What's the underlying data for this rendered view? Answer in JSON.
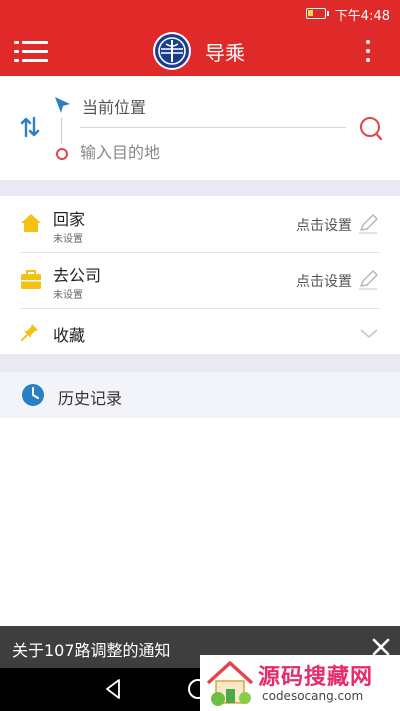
{
  "status_bar": {
    "time": "下午4:48",
    "battery_level": 0.35,
    "battery_color": "#ffd24a"
  },
  "app_bar": {
    "title": "导乘",
    "background_color": "#e02a2a",
    "menu_icon": "menu-icon",
    "logo_icon": "transit-logo-icon",
    "more_icon": "more-vertical-icon"
  },
  "route": {
    "start_text": "当前位置",
    "destination_placeholder": "输入目的地",
    "destination_value": "",
    "swap_icon": "swap-vertical-icon",
    "start_icon": "navigation-arrow-icon",
    "search_icon": "search-icon"
  },
  "places": {
    "home": {
      "label": "回家",
      "sub": "未设置",
      "action": "点击设置",
      "icon": "home-icon"
    },
    "company": {
      "label": "去公司",
      "sub": "未设置",
      "action": "点击设置",
      "icon": "briefcase-icon"
    },
    "favorites": {
      "label": "收藏",
      "icon": "pin-icon"
    }
  },
  "history": {
    "label": "历史记录",
    "icon": "clock-icon"
  },
  "notice": {
    "text": "关于107路调整的通知",
    "close_icon": "close-icon"
  },
  "watermark": {
    "title": "源码搜藏网",
    "url": "codesocang.com"
  }
}
